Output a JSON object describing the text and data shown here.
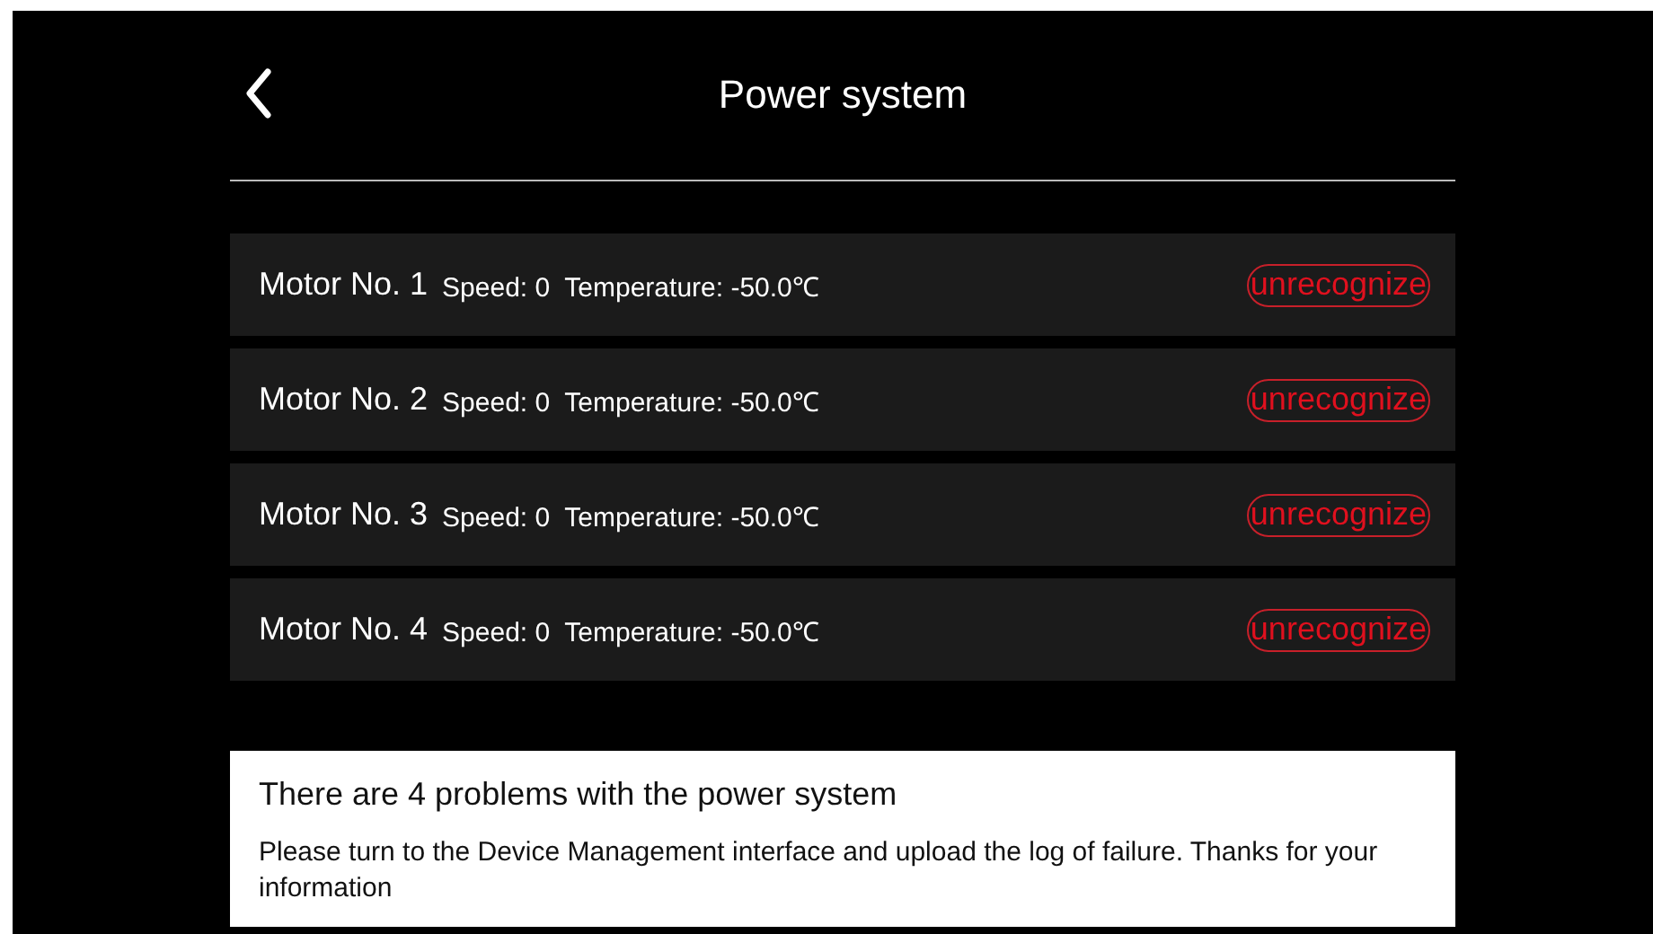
{
  "header": {
    "title": "Power system"
  },
  "motors": [
    {
      "name": "Motor No. 1",
      "details": "Speed: 0  Temperature: -50.0℃",
      "status": "unrecognize",
      "fault": true
    },
    {
      "name": "Motor No. 2",
      "details": "Speed: 0  Temperature: -50.0℃",
      "status": "unrecognize",
      "fault": true
    },
    {
      "name": "Motor No. 3",
      "details": "Speed: 0  Temperature: -50.0℃",
      "status": "unrecognize",
      "fault": true
    },
    {
      "name": "Motor No. 4",
      "details": "Speed: 0  Temperature: -50.0℃",
      "status": "unrecognize",
      "fault": true
    }
  ],
  "notice": {
    "title": "There are 4 problems with the power system",
    "message": "Please turn to the Device Management interface and upload the log of failure. Thanks for your information"
  }
}
